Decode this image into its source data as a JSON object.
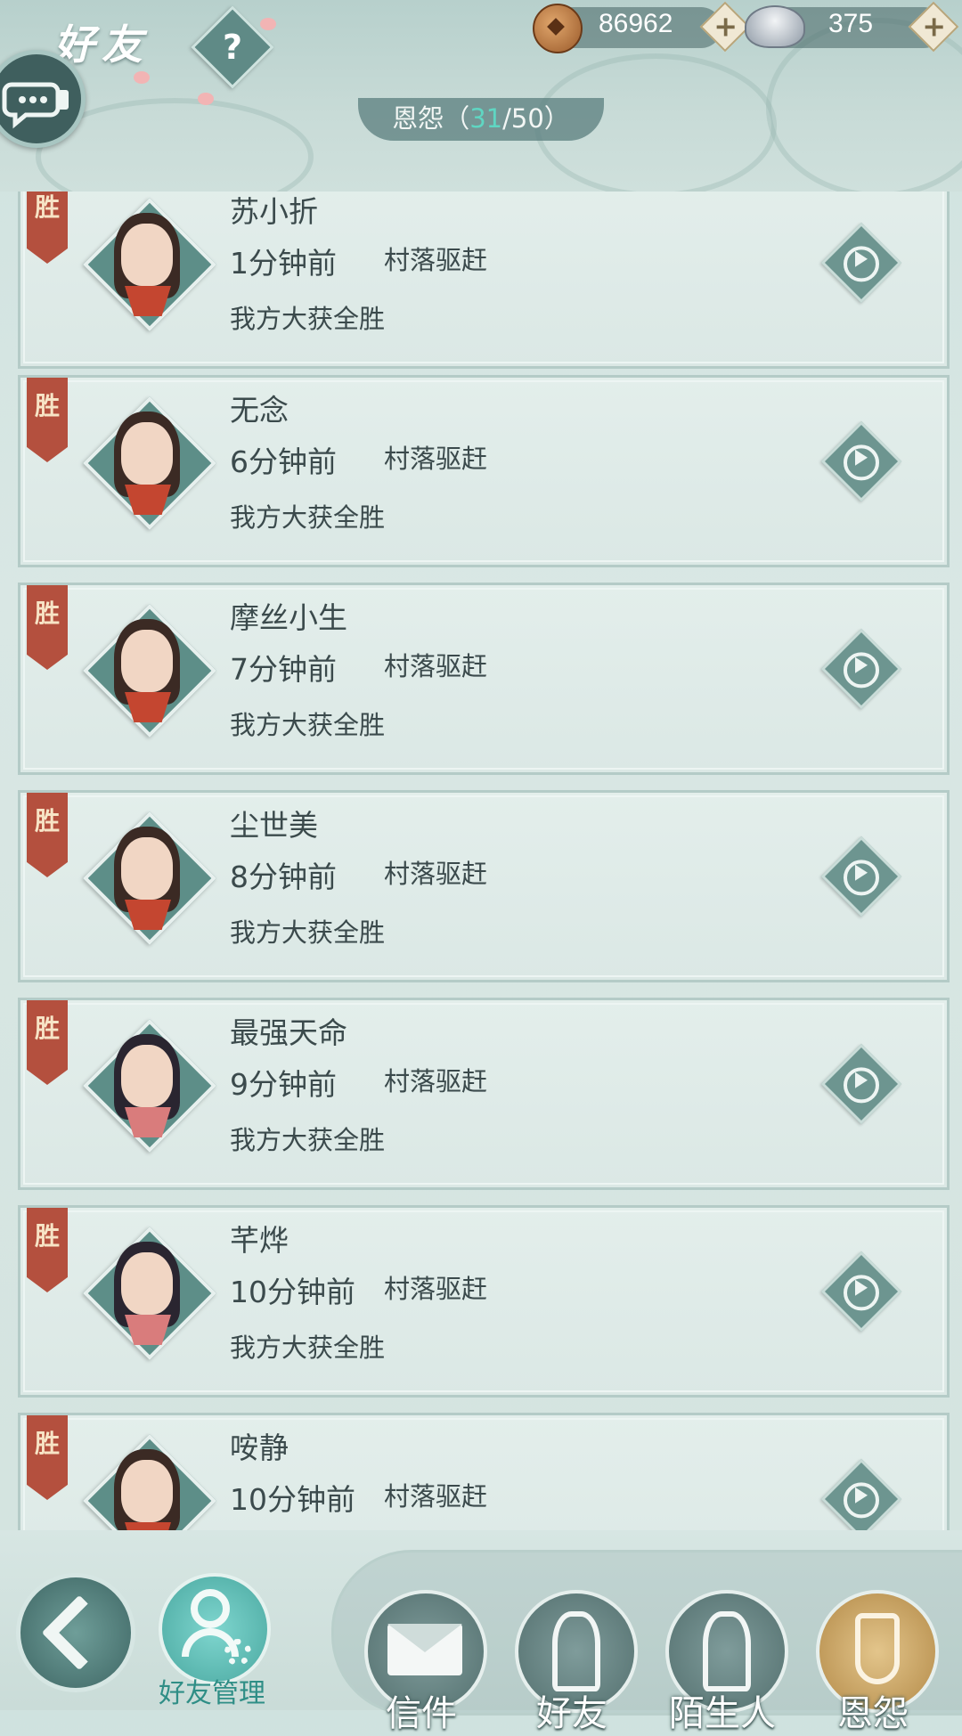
{
  "header": {
    "title": "好友",
    "help_label": "?",
    "copper": "86962",
    "silver": "375",
    "plus_label": "+",
    "subtab": {
      "label": "恩怨",
      "open": "（",
      "current": "31",
      "sep": "/",
      "max": "50",
      "close": "）"
    }
  },
  "records": [
    {
      "tag": "胜",
      "name": "苏小折",
      "time": "1分钟前",
      "mode": "村落驱赶",
      "result": "我方大获全胜",
      "avatar": "male"
    },
    {
      "tag": "胜",
      "name": "无念",
      "time": "6分钟前",
      "mode": "村落驱赶",
      "result": "我方大获全胜",
      "avatar": "male"
    },
    {
      "tag": "胜",
      "name": "摩丝小生",
      "time": "7分钟前",
      "mode": "村落驱赶",
      "result": "我方大获全胜",
      "avatar": "male"
    },
    {
      "tag": "胜",
      "name": "尘世美",
      "time": "8分钟前",
      "mode": "村落驱赶",
      "result": "我方大获全胜",
      "avatar": "male"
    },
    {
      "tag": "胜",
      "name": "最强天命",
      "time": "9分钟前",
      "mode": "村落驱赶",
      "result": "我方大获全胜",
      "avatar": "female"
    },
    {
      "tag": "胜",
      "name": "芊烨",
      "time": "10分钟前",
      "mode": "村落驱赶",
      "result": "我方大获全胜",
      "avatar": "female"
    },
    {
      "tag": "胜",
      "name": "咹静",
      "time": "10分钟前",
      "mode": "村落驱赶",
      "result": "",
      "avatar": "male"
    }
  ],
  "bottom": {
    "manage_label": "好友管理",
    "tabs": [
      {
        "label": "信件",
        "icon": "envelope-icon"
      },
      {
        "label": "好友",
        "icon": "friend-icon"
      },
      {
        "label": "陌生人",
        "icon": "stranger-icon"
      },
      {
        "label": "恩怨",
        "icon": "grudge-icon",
        "active": true
      }
    ]
  },
  "colors": {
    "win_tag": "#b4503e",
    "accent_count": "#5fd6c2",
    "active_tab": "#c9a25e"
  }
}
